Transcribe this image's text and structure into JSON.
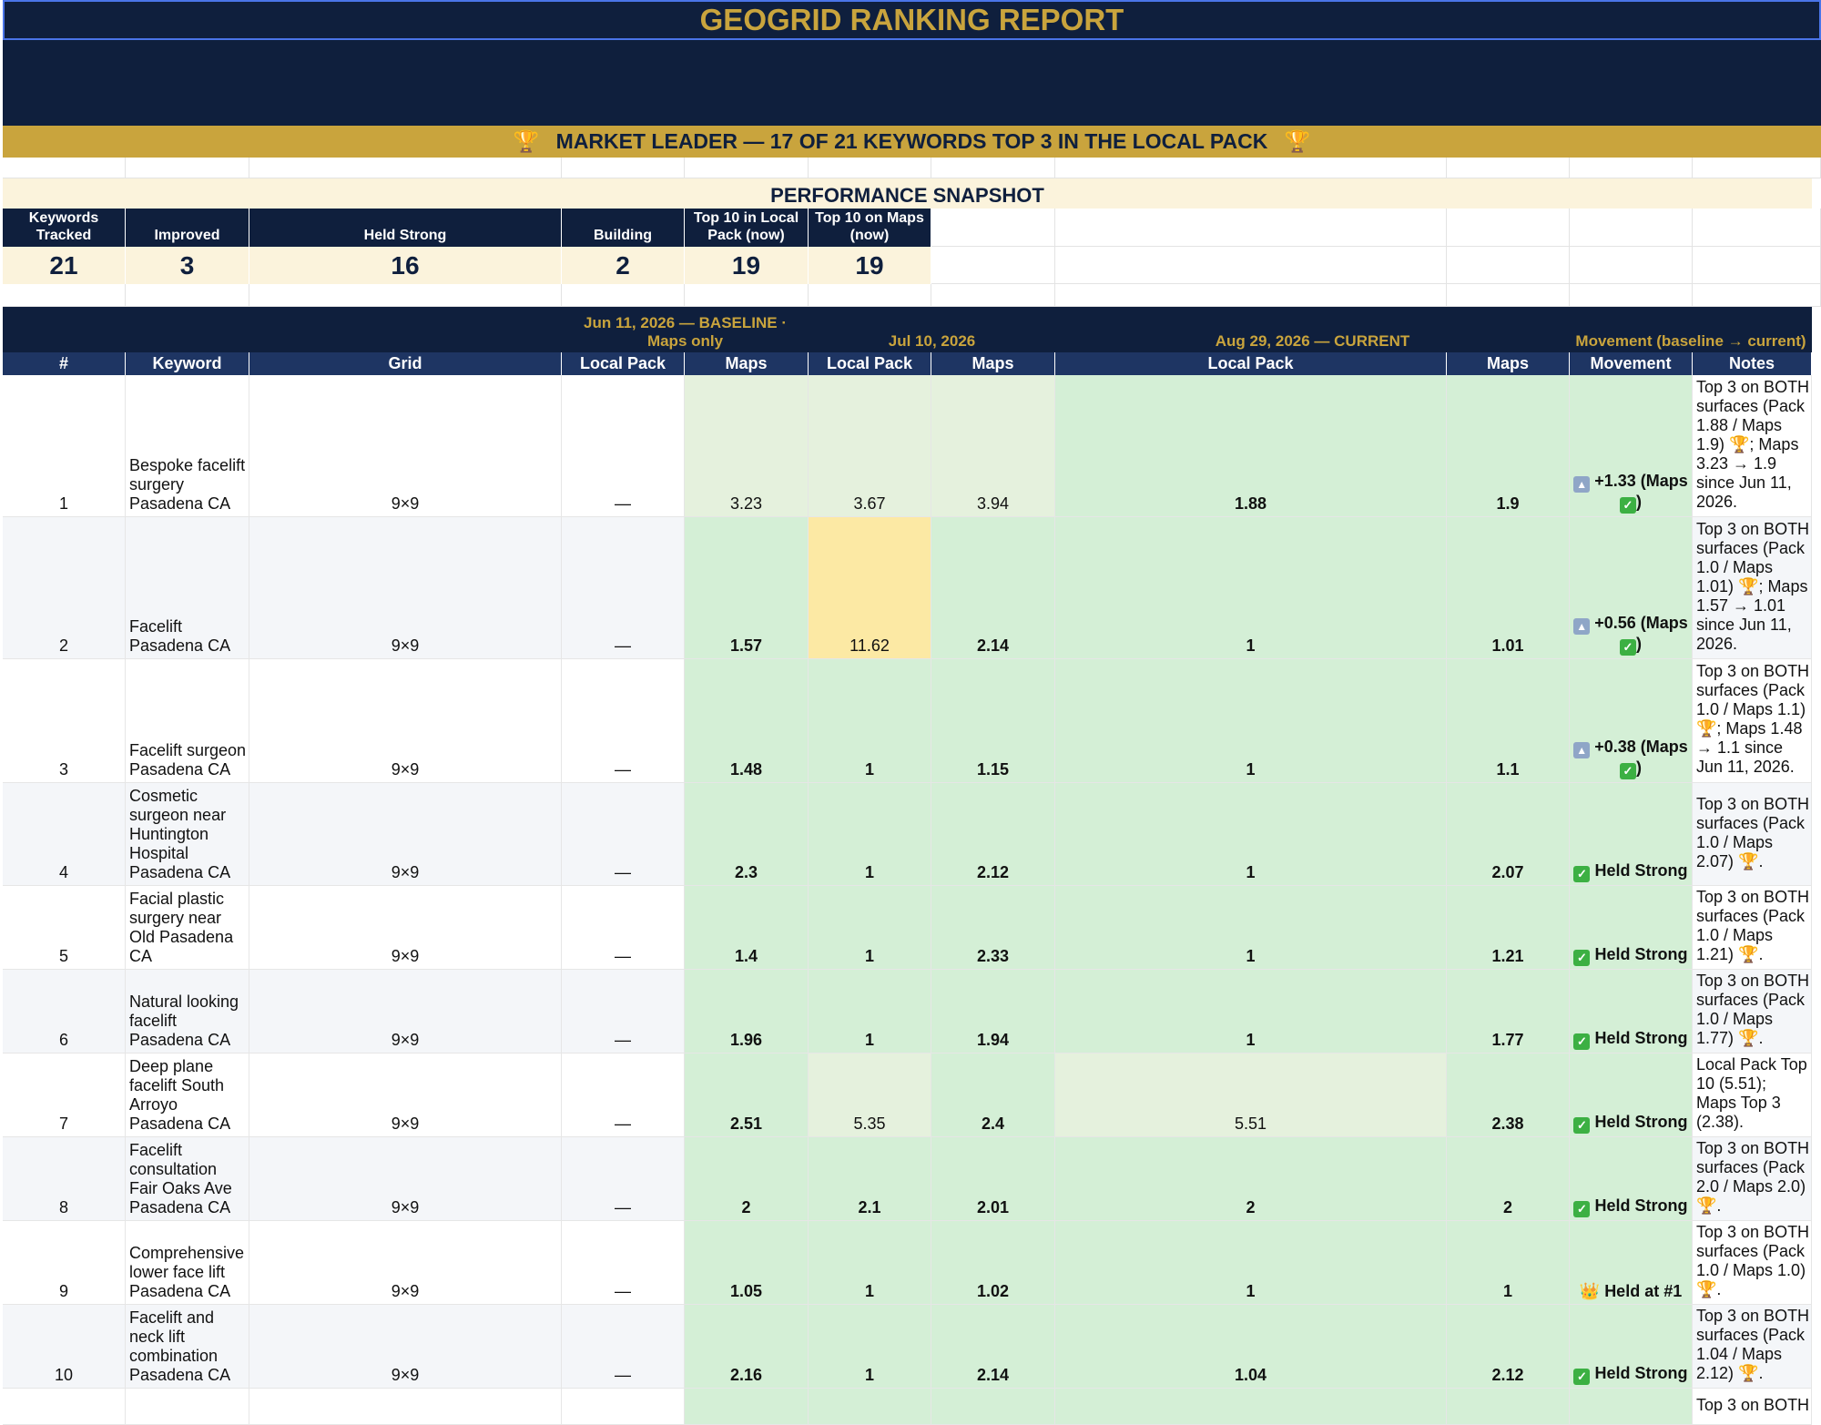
{
  "report": {
    "title": "GEOGRID RANKING REPORT",
    "banner": "MARKET LEADER — 17 OF 21 KEYWORDS TOP 3 IN THE LOCAL PACK",
    "banner_icon": "trophy-icon"
  },
  "snapshot": {
    "title": "PERFORMANCE SNAPSHOT",
    "kpis": [
      {
        "label": "Keywords Tracked",
        "value": "21"
      },
      {
        "label": "Improved",
        "value": "3"
      },
      {
        "label": "Held Strong",
        "value": "16"
      },
      {
        "label": "Building",
        "value": "2"
      },
      {
        "label": "Top 10 in Local Pack (now)",
        "value": "19"
      },
      {
        "label": "Top 10 on Maps (now)",
        "value": "19"
      }
    ]
  },
  "periods": {
    "baseline": "Jun 11, 2026 — BASELINE · Maps only",
    "mid": "Jul 10, 2026",
    "current": "Aug 29, 2026 — CURRENT",
    "movement": "Movement (baseline → current)"
  },
  "columns": [
    "#",
    "Keyword",
    "Grid",
    "Local Pack",
    "Maps",
    "Local Pack",
    "Maps",
    "Local Pack",
    "Maps",
    "Movement",
    "Notes"
  ],
  "rows": [
    {
      "num": "1",
      "keyword": "Bespoke facelift surgery Pasadena CA",
      "grid": "9×9",
      "base_pack": "—",
      "base_maps": "3.23",
      "mid_pack": "3.67",
      "mid_maps": "3.94",
      "cur_pack": "1.88",
      "cur_maps": "1.9",
      "movement_icon": "up-arrow-icon",
      "movement": "+1.33 (Maps",
      "movement_suffix": "check-icon",
      "notes": "Top 3 on BOTH surfaces (Pack 1.88 / Maps 1.9) 🏆; Maps 3.23 → 1.9 since Jun 11, 2026."
    },
    {
      "num": "2",
      "keyword": "Facelift Pasadena CA",
      "grid": "9×9",
      "base_pack": "—",
      "base_maps": "1.57",
      "mid_pack": "11.62",
      "mid_maps": "2.14",
      "cur_pack": "1",
      "cur_maps": "1.01",
      "movement_icon": "up-arrow-icon",
      "movement": "+0.56 (Maps",
      "movement_suffix": "check-icon",
      "notes": "Top 3 on BOTH surfaces (Pack 1.0 / Maps 1.01) 🏆; Maps 1.57 → 1.01 since Jun 11, 2026."
    },
    {
      "num": "3",
      "keyword": "Facelift surgeon Pasadena CA",
      "grid": "9×9",
      "base_pack": "—",
      "base_maps": "1.48",
      "mid_pack": "1",
      "mid_maps": "1.15",
      "cur_pack": "1",
      "cur_maps": "1.1",
      "movement_icon": "up-arrow-icon",
      "movement": "+0.38 (Maps",
      "movement_suffix": "check-icon",
      "notes": "Top 3 on BOTH surfaces (Pack 1.0 / Maps 1.1) 🏆; Maps 1.48 → 1.1 since Jun 11, 2026."
    },
    {
      "num": "4",
      "keyword": "Cosmetic surgeon near Huntington Hospital Pasadena CA",
      "grid": "9×9",
      "base_pack": "—",
      "base_maps": "2.3",
      "mid_pack": "1",
      "mid_maps": "2.12",
      "cur_pack": "1",
      "cur_maps": "2.07",
      "movement_icon": "check-icon",
      "movement": "Held Strong",
      "notes": "Top 3 on BOTH surfaces (Pack 1.0 / Maps 2.07) 🏆."
    },
    {
      "num": "5",
      "keyword": "Facial plastic surgery near Old Pasadena CA",
      "grid": "9×9",
      "base_pack": "—",
      "base_maps": "1.4",
      "mid_pack": "1",
      "mid_maps": "2.33",
      "cur_pack": "1",
      "cur_maps": "1.21",
      "movement_icon": "check-icon",
      "movement": "Held Strong",
      "notes": "Top 3 on BOTH surfaces (Pack 1.0 / Maps 1.21) 🏆."
    },
    {
      "num": "6",
      "keyword": "Natural looking facelift Pasadena CA",
      "grid": "9×9",
      "base_pack": "—",
      "base_maps": "1.96",
      "mid_pack": "1",
      "mid_maps": "1.94",
      "cur_pack": "1",
      "cur_maps": "1.77",
      "movement_icon": "check-icon",
      "movement": "Held Strong",
      "notes": "Top 3 on BOTH surfaces (Pack 1.0 / Maps 1.77) 🏆."
    },
    {
      "num": "7",
      "keyword": "Deep plane facelift South Arroyo Pasadena CA",
      "grid": "9×9",
      "base_pack": "—",
      "base_maps": "2.51",
      "mid_pack": "5.35",
      "mid_maps": "2.4",
      "cur_pack": "5.51",
      "cur_maps": "2.38",
      "movement_icon": "check-icon",
      "movement": "Held Strong",
      "notes": "Local Pack Top 10 (5.51); Maps Top 3 (2.38)."
    },
    {
      "num": "8",
      "keyword": "Facelift consultation Fair Oaks Ave Pasadena CA",
      "grid": "9×9",
      "base_pack": "—",
      "base_maps": "2",
      "mid_pack": "2.1",
      "mid_maps": "2.01",
      "cur_pack": "2",
      "cur_maps": "2",
      "movement_icon": "check-icon",
      "movement": "Held Strong",
      "notes": "Top 3 on BOTH surfaces (Pack 2.0 / Maps 2.0) 🏆."
    },
    {
      "num": "9",
      "keyword": "Comprehensive lower face lift Pasadena CA",
      "grid": "9×9",
      "base_pack": "—",
      "base_maps": "1.05",
      "mid_pack": "1",
      "mid_maps": "1.02",
      "cur_pack": "1",
      "cur_maps": "1",
      "movement_icon": "crown-icon",
      "movement": "Held at #1",
      "notes": "Top 3 on BOTH surfaces (Pack 1.0 / Maps 1.0) 🏆."
    },
    {
      "num": "10",
      "keyword": "Facelift and neck lift combination Pasadena CA",
      "grid": "9×9",
      "base_pack": "—",
      "base_maps": "2.16",
      "mid_pack": "1",
      "mid_maps": "2.14",
      "cur_pack": "1.04",
      "cur_maps": "2.12",
      "movement_icon": "check-icon",
      "movement": "Held Strong",
      "notes": "Top 3 on BOTH surfaces (Pack 1.04 / Maps 2.12) 🏆."
    },
    {
      "num": "",
      "keyword": "",
      "grid": "",
      "base_pack": "",
      "base_maps": "",
      "mid_pack": "",
      "mid_maps": "",
      "cur_pack": "",
      "cur_maps": "",
      "movement_icon": "",
      "movement": "",
      "notes": "Top 3 on BOTH"
    }
  ]
}
